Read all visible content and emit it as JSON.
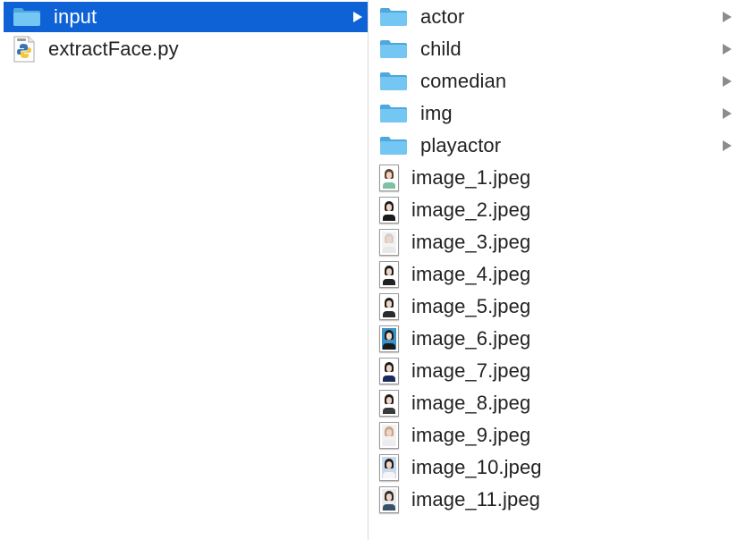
{
  "left_column": {
    "items": [
      {
        "label": "input",
        "type": "folder",
        "selected": true
      },
      {
        "label": "extractFace.py",
        "type": "python-file",
        "selected": false
      }
    ]
  },
  "right_column": {
    "folders": [
      {
        "label": "actor"
      },
      {
        "label": "child"
      },
      {
        "label": "comedian"
      },
      {
        "label": "img"
      },
      {
        "label": "playactor"
      }
    ],
    "files": [
      {
        "label": "image_1.jpeg",
        "bg": "#ffffff",
        "hair": "#5a4032",
        "body": "#7fc1a5"
      },
      {
        "label": "image_2.jpeg",
        "bg": "#ffffff",
        "hair": "#1b1b1b",
        "body": "#1b1b1b"
      },
      {
        "label": "image_3.jpeg",
        "bg": "#f3f3f3",
        "hair": "#cfcfcf",
        "body": "#e8e8e8"
      },
      {
        "label": "image_4.jpeg",
        "bg": "#ffffff",
        "hair": "#1b1b1b",
        "body": "#222222"
      },
      {
        "label": "image_5.jpeg",
        "bg": "#ffffff",
        "hair": "#1b1b1b",
        "body": "#2b2b2b"
      },
      {
        "label": "image_6.jpeg",
        "bg": "#3a92c9",
        "hair": "#1b1b1b",
        "body": "#1b1b1b"
      },
      {
        "label": "image_7.jpeg",
        "bg": "#ffffff",
        "hair": "#1b1b1b",
        "body": "#1c2a5a"
      },
      {
        "label": "image_8.jpeg",
        "bg": "#ffffff",
        "hair": "#1b1b1b",
        "body": "#3a3a3a"
      },
      {
        "label": "image_9.jpeg",
        "bg": "#f2f2f2",
        "hair": "#bfa592",
        "body": "#ececec"
      },
      {
        "label": "image_10.jpeg",
        "bg": "#c8d9ee",
        "hair": "#1b1b1b",
        "body": "#f5f5f5"
      },
      {
        "label": "image_11.jpeg",
        "bg": "#ececec",
        "hair": "#2a2a2a",
        "body": "#39506b"
      }
    ]
  },
  "colors": {
    "selection": "#0f62d6",
    "folder_body": "#6cc3f2",
    "folder_tab": "#4ea7dd"
  }
}
